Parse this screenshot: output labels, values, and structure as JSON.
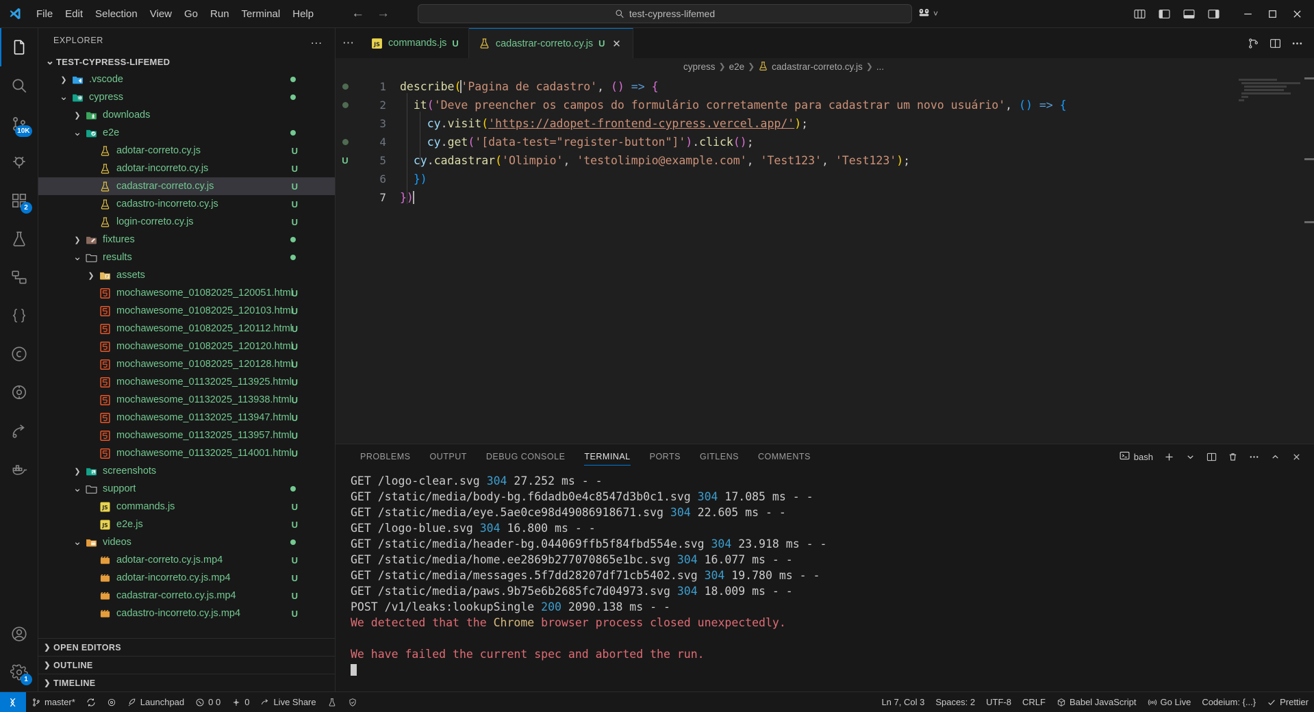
{
  "titlebar": {
    "menus": [
      "File",
      "Edit",
      "Selection",
      "View",
      "Go",
      "Run",
      "Terminal",
      "Help"
    ],
    "search_value": "test-cypress-lifemed",
    "search_icon": "search-icon",
    "back_icon": "arrow-left-icon",
    "forward_icon": "arrow-right-icon",
    "remote_icon": "remote-explorer-icon",
    "layout_icons": [
      "customize-layout-icon",
      "toggle-primary-sidebar-icon",
      "toggle-panel-icon",
      "toggle-secondary-sidebar-icon"
    ],
    "window_controls": [
      "minimize-icon",
      "maximize-icon",
      "close-icon"
    ]
  },
  "activitybar": {
    "items": [
      {
        "name": "explorer",
        "icon": "files-icon",
        "badge": ""
      },
      {
        "name": "search",
        "icon": "search-icon",
        "badge": ""
      },
      {
        "name": "source-control",
        "icon": "source-control-icon",
        "badge": "10K"
      },
      {
        "name": "run-and-debug",
        "icon": "debug-icon",
        "badge": ""
      },
      {
        "name": "extensions",
        "icon": "extensions-icon",
        "badge": "2"
      },
      {
        "name": "testing",
        "icon": "beaker-icon",
        "badge": ""
      },
      {
        "name": "remote-explorer",
        "icon": "remote-icon",
        "badge": ""
      },
      {
        "name": "json-crack",
        "icon": "braces-icon",
        "badge": ""
      },
      {
        "name": "cypress",
        "icon": "cypress-icon",
        "badge": ""
      },
      {
        "name": "gitlens",
        "icon": "gitlens-icon",
        "badge": ""
      },
      {
        "name": "live-share",
        "icon": "liveshare-icon",
        "badge": ""
      },
      {
        "name": "docker",
        "icon": "docker-icon",
        "badge": ""
      }
    ],
    "bottom": [
      {
        "name": "accounts",
        "icon": "account-icon",
        "badge": ""
      },
      {
        "name": "settings",
        "icon": "gear-icon",
        "badge": "1"
      }
    ]
  },
  "sidebar": {
    "title": "EXPLORER",
    "more_actions": "...",
    "tree": [
      {
        "label": "TEST-CYPRESS-LIFEMED",
        "depth": 0,
        "type": "root",
        "twisty": "down",
        "icon": "",
        "badge": "",
        "dot": false,
        "selected": false
      },
      {
        "label": ".vscode",
        "depth": 1,
        "type": "folder",
        "twisty": "right",
        "icon": "folder-vscode-icon",
        "badge": "",
        "dot": true,
        "selected": false
      },
      {
        "label": "cypress",
        "depth": 1,
        "type": "folder",
        "twisty": "down",
        "icon": "folder-cypress-icon",
        "badge": "",
        "dot": true,
        "selected": false
      },
      {
        "label": "downloads",
        "depth": 2,
        "type": "folder",
        "twisty": "right",
        "icon": "folder-download-icon",
        "badge": "",
        "dot": false,
        "selected": false
      },
      {
        "label": "e2e",
        "depth": 2,
        "type": "folder",
        "twisty": "down",
        "icon": "folder-e2e-icon",
        "badge": "",
        "dot": true,
        "selected": false
      },
      {
        "label": "adotar-correto.cy.js",
        "depth": 3,
        "type": "test",
        "twisty": "",
        "icon": "beaker-file-icon",
        "badge": "U",
        "dot": false,
        "selected": false
      },
      {
        "label": "adotar-incorreto.cy.js",
        "depth": 3,
        "type": "test",
        "twisty": "",
        "icon": "beaker-file-icon",
        "badge": "U",
        "dot": false,
        "selected": false
      },
      {
        "label": "cadastrar-correto.cy.js",
        "depth": 3,
        "type": "test",
        "twisty": "",
        "icon": "beaker-file-icon",
        "badge": "U",
        "dot": false,
        "selected": true
      },
      {
        "label": "cadastro-incorreto.cy.js",
        "depth": 3,
        "type": "test",
        "twisty": "",
        "icon": "beaker-file-icon",
        "badge": "U",
        "dot": false,
        "selected": false
      },
      {
        "label": "login-correto.cy.js",
        "depth": 3,
        "type": "test",
        "twisty": "",
        "icon": "beaker-file-icon",
        "badge": "U",
        "dot": false,
        "selected": false
      },
      {
        "label": "fixtures",
        "depth": 2,
        "type": "folder",
        "twisty": "right",
        "icon": "folder-fixtures-icon",
        "badge": "",
        "dot": true,
        "selected": false
      },
      {
        "label": "results",
        "depth": 2,
        "type": "folder",
        "twisty": "down",
        "icon": "folder-icon",
        "badge": "",
        "dot": true,
        "selected": false
      },
      {
        "label": "assets",
        "depth": 3,
        "type": "folder",
        "twisty": "right",
        "icon": "folder-assets-icon",
        "badge": "",
        "dot": false,
        "selected": false
      },
      {
        "label": "mochawesome_01082025_120051.html",
        "depth": 3,
        "type": "html",
        "twisty": "",
        "icon": "html5-icon",
        "badge": "U",
        "dot": false,
        "selected": false
      },
      {
        "label": "mochawesome_01082025_120103.html",
        "depth": 3,
        "type": "html",
        "twisty": "",
        "icon": "html5-icon",
        "badge": "U",
        "dot": false,
        "selected": false
      },
      {
        "label": "mochawesome_01082025_120112.html",
        "depth": 3,
        "type": "html",
        "twisty": "",
        "icon": "html5-icon",
        "badge": "U",
        "dot": false,
        "selected": false
      },
      {
        "label": "mochawesome_01082025_120120.html",
        "depth": 3,
        "type": "html",
        "twisty": "",
        "icon": "html5-icon",
        "badge": "U",
        "dot": false,
        "selected": false
      },
      {
        "label": "mochawesome_01082025_120128.html",
        "depth": 3,
        "type": "html",
        "twisty": "",
        "icon": "html5-icon",
        "badge": "U",
        "dot": false,
        "selected": false
      },
      {
        "label": "mochawesome_01132025_113925.html",
        "depth": 3,
        "type": "html",
        "twisty": "",
        "icon": "html5-icon",
        "badge": "U",
        "dot": false,
        "selected": false
      },
      {
        "label": "mochawesome_01132025_113938.html",
        "depth": 3,
        "type": "html",
        "twisty": "",
        "icon": "html5-icon",
        "badge": "U",
        "dot": false,
        "selected": false
      },
      {
        "label": "mochawesome_01132025_113947.html",
        "depth": 3,
        "type": "html",
        "twisty": "",
        "icon": "html5-icon",
        "badge": "U",
        "dot": false,
        "selected": false
      },
      {
        "label": "mochawesome_01132025_113957.html",
        "depth": 3,
        "type": "html",
        "twisty": "",
        "icon": "html5-icon",
        "badge": "U",
        "dot": false,
        "selected": false
      },
      {
        "label": "mochawesome_01132025_114001.html",
        "depth": 3,
        "type": "html",
        "twisty": "",
        "icon": "html5-icon",
        "badge": "U",
        "dot": false,
        "selected": false
      },
      {
        "label": "screenshots",
        "depth": 2,
        "type": "folder",
        "twisty": "right",
        "icon": "folder-images-icon",
        "badge": "",
        "dot": false,
        "selected": false
      },
      {
        "label": "support",
        "depth": 2,
        "type": "folder",
        "twisty": "down",
        "icon": "folder-icon",
        "badge": "",
        "dot": true,
        "selected": false
      },
      {
        "label": "commands.js",
        "depth": 3,
        "type": "js",
        "twisty": "",
        "icon": "js-icon",
        "badge": "U",
        "dot": false,
        "selected": false
      },
      {
        "label": "e2e.js",
        "depth": 3,
        "type": "js",
        "twisty": "",
        "icon": "js-icon",
        "badge": "U",
        "dot": false,
        "selected": false
      },
      {
        "label": "videos",
        "depth": 2,
        "type": "folder",
        "twisty": "down",
        "icon": "folder-video-icon",
        "badge": "",
        "dot": true,
        "selected": false
      },
      {
        "label": "adotar-correto.cy.js.mp4",
        "depth": 3,
        "type": "video",
        "twisty": "",
        "icon": "video-icon",
        "badge": "U",
        "dot": false,
        "selected": false
      },
      {
        "label": "adotar-incorreto.cy.js.mp4",
        "depth": 3,
        "type": "video",
        "twisty": "",
        "icon": "video-icon",
        "badge": "U",
        "dot": false,
        "selected": false
      },
      {
        "label": "cadastrar-correto.cy.js.mp4",
        "depth": 3,
        "type": "video",
        "twisty": "",
        "icon": "video-icon",
        "badge": "U",
        "dot": false,
        "selected": false
      },
      {
        "label": "cadastro-incorreto.cy.js.mp4",
        "depth": 3,
        "type": "video",
        "twisty": "",
        "icon": "video-icon",
        "badge": "U",
        "dot": false,
        "selected": false
      }
    ],
    "sections": [
      "OPEN EDITORS",
      "OUTLINE",
      "TIMELINE"
    ]
  },
  "editor": {
    "tabs": [
      {
        "label": "commands.js",
        "badge": "U",
        "icon": "js-icon",
        "active": false,
        "closable": false
      },
      {
        "label": "cadastrar-correto.cy.js",
        "badge": "U",
        "icon": "beaker-file-icon",
        "active": true,
        "closable": true
      }
    ],
    "tab_actions": [
      "split-editor-icon",
      "layout-editor-icon",
      "more-actions-icon"
    ],
    "breadcrumbs": [
      "cypress",
      "e2e",
      "cadastrar-correto.cy.js",
      "..."
    ],
    "breadcrumb_file_icon": "beaker-file-icon",
    "line_numbers": [
      "1",
      "2",
      "3",
      "4",
      "5",
      "6",
      "7"
    ],
    "glyphs": [
      "dot",
      "dot",
      "",
      "dot",
      "U",
      "",
      ""
    ],
    "code": {
      "l1_fn": "describe",
      "l1_str": "'Pagina de cadastro'",
      "l1_tail": ", () => {",
      "l2_fn": "it",
      "l2_str": "'Deve preencher os campos do formulário corretamente para cadastrar um novo usuário'",
      "l2_tail": ", () => {",
      "l3_obj": "cy",
      "l3_fn": "visit",
      "l3_url": "'https://adopet-frontend-cypress.vercel.app/'",
      "l3_tail": ");",
      "l4_obj": "cy",
      "l4_fn": "get",
      "l4_str": "'[data-test=\"register-button\"]'",
      "l4_mid": ").",
      "l4_fn2": "click",
      "l4_tail": "();",
      "l5_obj": "cy",
      "l5_fn": "cadastrar",
      "l5_a1": "'Olimpio'",
      "l5_a2": "'testolimpio@example.com'",
      "l5_a3": "'Test123'",
      "l5_a4": "'Test123'",
      "l6": "})",
      "l7": "})"
    }
  },
  "panel": {
    "tabs": [
      "PROBLEMS",
      "OUTPUT",
      "DEBUG CONSOLE",
      "TERMINAL",
      "PORTS",
      "GITLENS",
      "COMMENTS"
    ],
    "active_tab": "TERMINAL",
    "shell_label": "bash",
    "shell_icon": "terminal-bash-icon",
    "actions": [
      "new-terminal-icon",
      "chevron-down-icon",
      "split-terminal-icon",
      "kill-terminal-icon",
      "more-actions-icon",
      "chevron-up-icon",
      "close-icon"
    ],
    "terminal_lines": [
      {
        "segments": [
          {
            "t": "GET /logo-clear.svg ",
            "c": "plain"
          },
          {
            "t": "304",
            "c": "num"
          },
          {
            "t": " 27.252 ms - -",
            "c": "plain"
          }
        ]
      },
      {
        "segments": [
          {
            "t": "GET /static/media/body-bg.f6dadb0e4c8547d3b0c1.svg ",
            "c": "plain"
          },
          {
            "t": "304",
            "c": "num"
          },
          {
            "t": " 17.085 ms - -",
            "c": "plain"
          }
        ]
      },
      {
        "segments": [
          {
            "t": "GET /static/media/eye.5ae0ce98d49086918671.svg ",
            "c": "plain"
          },
          {
            "t": "304",
            "c": "num"
          },
          {
            "t": " 22.605 ms - -",
            "c": "plain"
          }
        ]
      },
      {
        "segments": [
          {
            "t": "GET /logo-blue.svg ",
            "c": "plain"
          },
          {
            "t": "304",
            "c": "num"
          },
          {
            "t": " 16.800 ms - -",
            "c": "plain"
          }
        ]
      },
      {
        "segments": [
          {
            "t": "GET /static/media/header-bg.044069ffb5f84fbd554e.svg ",
            "c": "plain"
          },
          {
            "t": "304",
            "c": "num"
          },
          {
            "t": " 23.918 ms - -",
            "c": "plain"
          }
        ]
      },
      {
        "segments": [
          {
            "t": "GET /static/media/home.ee2869b277070865e1bc.svg ",
            "c": "plain"
          },
          {
            "t": "304",
            "c": "num"
          },
          {
            "t": " 16.077 ms - -",
            "c": "plain"
          }
        ]
      },
      {
        "segments": [
          {
            "t": "GET /static/media/messages.5f7dd28207df71cb5402.svg ",
            "c": "plain"
          },
          {
            "t": "304",
            "c": "num"
          },
          {
            "t": " 19.780 ms - -",
            "c": "plain"
          }
        ]
      },
      {
        "segments": [
          {
            "t": "GET /static/media/paws.9b75e6b2685fc7d04973.svg ",
            "c": "plain"
          },
          {
            "t": "304",
            "c": "num"
          },
          {
            "t": " 18.009 ms - -",
            "c": "plain"
          }
        ]
      },
      {
        "segments": [
          {
            "t": "POST /v1/leaks:lookupSingle ",
            "c": "plain"
          },
          {
            "t": "200",
            "c": "num"
          },
          {
            "t": " 2090.138 ms - -",
            "c": "plain"
          }
        ]
      },
      {
        "segments": [
          {
            "t": "We detected that the ",
            "c": "warn"
          },
          {
            "t": "Chrome",
            "c": "yellow"
          },
          {
            "t": " browser process closed unexpectedly.",
            "c": "warn"
          }
        ]
      },
      {
        "segments": [
          {
            "t": "",
            "c": "plain"
          }
        ]
      },
      {
        "segments": [
          {
            "t": "We have failed the current spec and aborted the run.",
            "c": "warn"
          }
        ]
      }
    ]
  },
  "statusbar": {
    "remote_icon": "remote-window-icon",
    "left": [
      {
        "name": "git-branch",
        "icon": "source-control-icon",
        "label": "master*"
      },
      {
        "name": "sync-changes",
        "icon": "sync-icon",
        "label": ""
      },
      {
        "name": "gitlens-toggle",
        "icon": "gitlens-icon",
        "label": ""
      },
      {
        "name": "launchpad",
        "icon": "rocket-icon",
        "label": "Launchpad"
      },
      {
        "name": "problems",
        "icon": "error-warning-icon",
        "label": "0  0"
      },
      {
        "name": "ports",
        "icon": "ports-icon",
        "label": "0"
      },
      {
        "name": "live-share",
        "icon": "liveshare-icon",
        "label": "Live Share"
      },
      {
        "name": "flask-status",
        "icon": "beaker-icon",
        "label": ""
      },
      {
        "name": "shield-status",
        "icon": "shield-check-icon",
        "label": ""
      }
    ],
    "right": [
      {
        "name": "cursor-position",
        "icon": "",
        "label": "Ln 7, Col 3"
      },
      {
        "name": "indentation",
        "icon": "",
        "label": "Spaces: 2"
      },
      {
        "name": "encoding",
        "icon": "",
        "label": "UTF-8"
      },
      {
        "name": "eol",
        "icon": "",
        "label": "CRLF"
      },
      {
        "name": "language-mode",
        "icon": "babel-icon",
        "label": "Babel JavaScript"
      },
      {
        "name": "go-live",
        "icon": "broadcast-icon",
        "label": "Go Live"
      },
      {
        "name": "codeium",
        "icon": "",
        "label": "Codeium: {...}"
      },
      {
        "name": "prettier",
        "icon": "check-icon",
        "label": "Prettier"
      }
    ]
  }
}
